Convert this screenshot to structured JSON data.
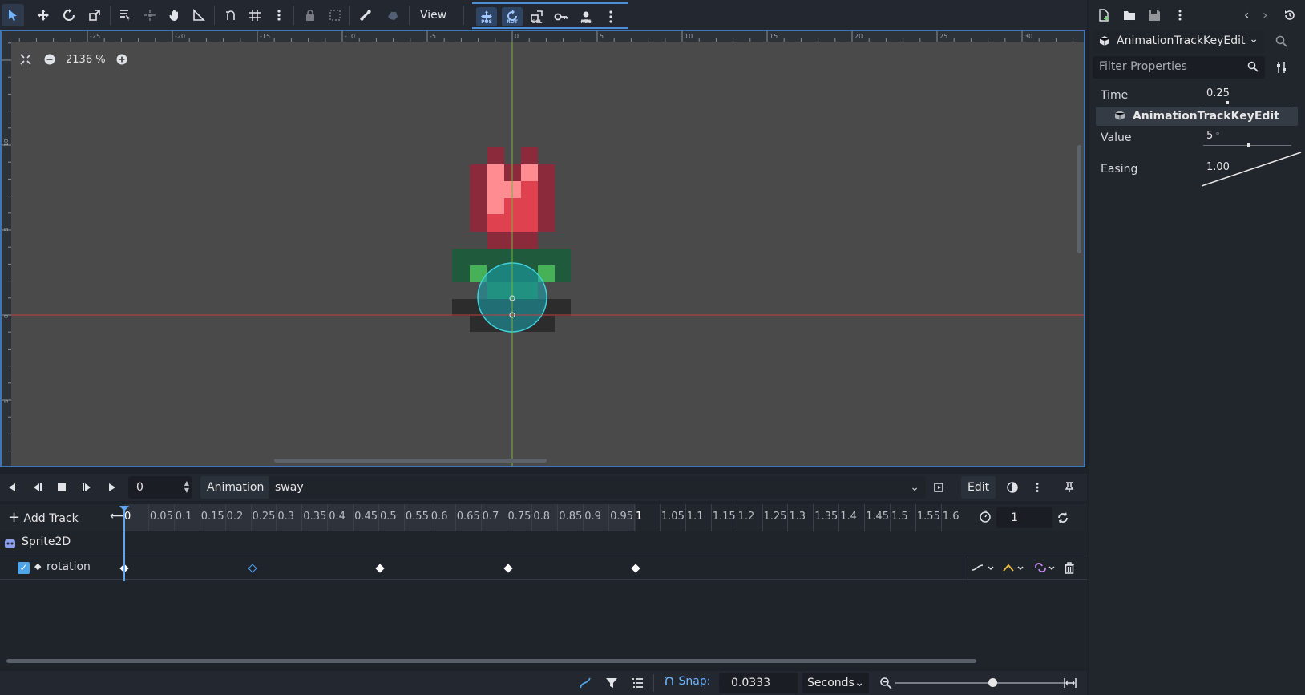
{
  "viewport": {
    "toolbar": {
      "view_menu_label": "View",
      "mode_buttons": [
        "POS",
        "ROT",
        "SCL",
        "KEY",
        "REC"
      ]
    },
    "zoom_label": "2136 %",
    "ruler_top_labels": [
      "-25",
      "-20",
      "-15",
      "-10",
      "-5",
      "0",
      "5",
      "10",
      "15",
      "20",
      "25",
      "30"
    ],
    "ruler_left_labels": [
      "-10",
      "-5",
      "0",
      "5"
    ]
  },
  "animation": {
    "current_frame": "0",
    "animation_button_label": "Animation",
    "selected_animation": "sway",
    "edit_label": "Edit",
    "add_track_label": "Add Track",
    "timeline_ticks": [
      "0",
      "0.05",
      "0.1",
      "0.15",
      "0.2",
      "0.25",
      "0.3",
      "0.35",
      "0.4",
      "0.45",
      "0.5",
      "0.55",
      "0.6",
      "0.65",
      "0.7",
      "0.75",
      "0.8",
      "0.85",
      "0.9",
      "0.95",
      "1",
      "1.05",
      "1.1",
      "1.15",
      "1.2",
      "1.25",
      "1.3",
      "1.35",
      "1.4",
      "1.45",
      "1.5",
      "1.55",
      "1.6"
    ],
    "animation_length": "1",
    "tracks": {
      "node_name": "Sprite2D",
      "property_name": "rotation",
      "keyframe_times": [
        0,
        0.25,
        0.5,
        0.75,
        1.0
      ],
      "selected_key_time": 0.25
    },
    "snap_label": "Snap:",
    "snap_value": "0.0333",
    "snap_unit": "Seconds"
  },
  "inspector": {
    "object_name": "AnimationTrackKeyEdit",
    "filter_placeholder": "Filter Properties",
    "time_label": "Time",
    "time_value": "0.25",
    "section_title": "AnimationTrackKeyEdit",
    "value_label": "Value",
    "value_value": "5",
    "value_unit": "°",
    "easing_label": "Easing",
    "easing_value": "1.00"
  },
  "colors": {
    "accent": "#4d8fd6",
    "canvas_bg": "#4a4a4a",
    "panel_bg": "#21262d",
    "selected_key": "#4aa3ff"
  }
}
